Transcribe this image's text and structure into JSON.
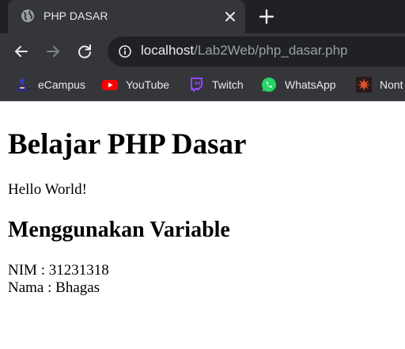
{
  "browser": {
    "tab": {
      "title": "PHP DASAR",
      "favicon": "globe-icon"
    },
    "toolbar": {
      "url_host": "localhost",
      "url_path": "/Lab2Web/php_dasar.php"
    },
    "bookmarks": [
      {
        "label": "eCampus",
        "icon": "ecampus-icon"
      },
      {
        "label": "YouTube",
        "icon": "youtube-icon"
      },
      {
        "label": "Twitch",
        "icon": "twitch-icon"
      },
      {
        "label": "WhatsApp",
        "icon": "whatsapp-icon"
      },
      {
        "label": "Nont",
        "icon": "nont-icon"
      }
    ]
  },
  "page": {
    "heading": "Belajar PHP Dasar",
    "hello": "Hello World!",
    "subheading": "Menggunakan Variable",
    "lines": [
      "NIM : 31231318",
      "Nama : Bhagas"
    ]
  },
  "colors": {
    "chrome_bg": "#202124",
    "toolbar_bg": "#35363a",
    "youtube_red": "#ff0000",
    "twitch_purple": "#9146ff",
    "whatsapp_green": "#25d366"
  }
}
